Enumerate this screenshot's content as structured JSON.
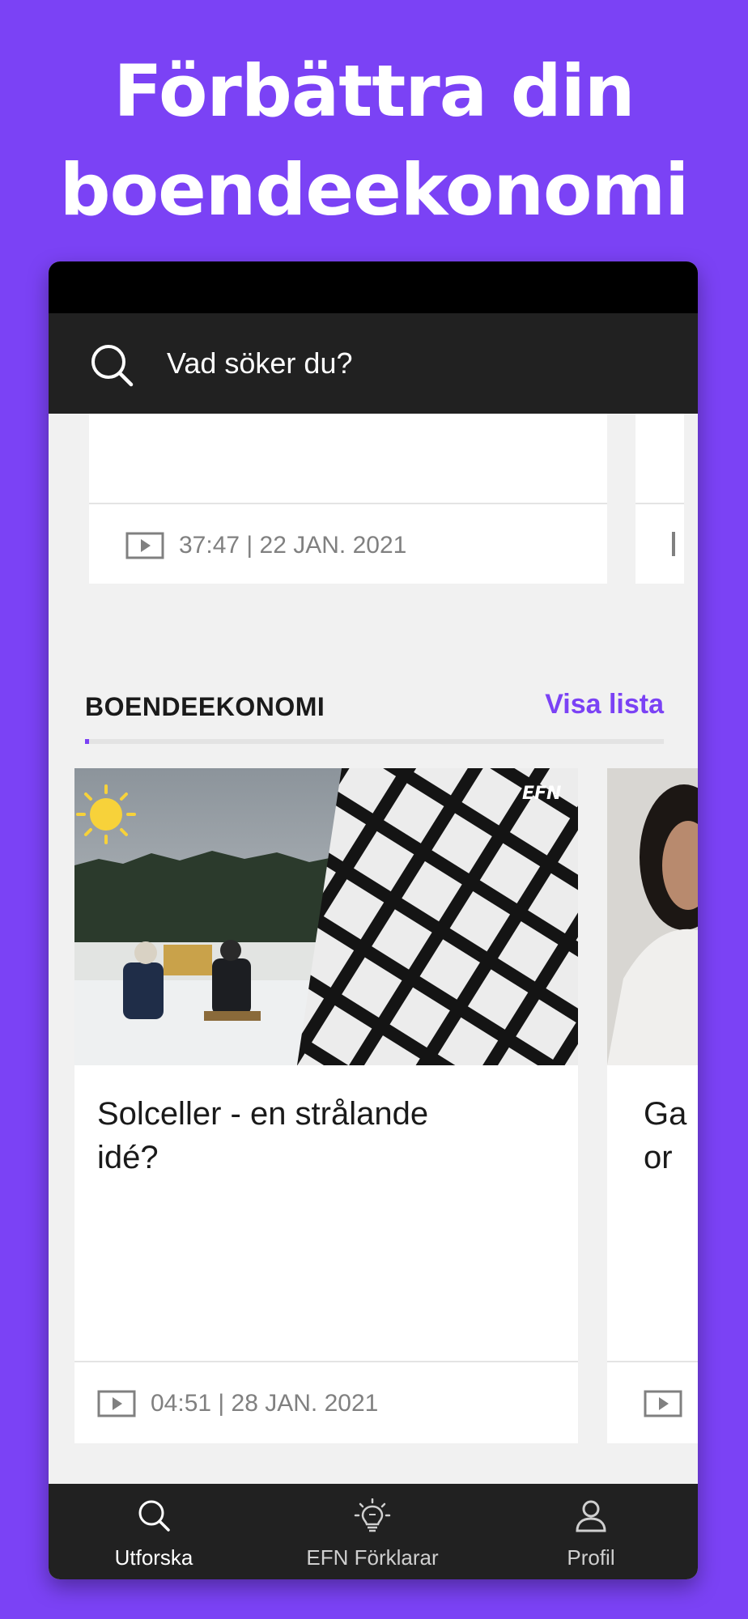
{
  "promo": {
    "headline_line1": "Förbättra din",
    "headline_line2": "boendeekonomi"
  },
  "search": {
    "placeholder": "Vad söker du?",
    "icon": "search-icon"
  },
  "previous_card": {
    "meta": "37:47 | 22 JAN. 2021",
    "icon": "play-icon"
  },
  "section": {
    "title": "BOENDEEKONOMI",
    "link_label": "Visa lista"
  },
  "cards": [
    {
      "title_line1": "Solceller - en strålande",
      "title_line2": "idé?",
      "meta": "04:51 | 28 JAN. 2021",
      "thumbnail_logo": "EFN",
      "thumbnail_icon": "sun-icon"
    },
    {
      "title_line1": "Ga",
      "title_line2": "or"
    }
  ],
  "tabs": [
    {
      "label": "Utforska",
      "icon": "search-icon",
      "active": true
    },
    {
      "label": "EFN Förklarar",
      "icon": "lightbulb-icon",
      "active": false
    },
    {
      "label": "Profil",
      "icon": "person-icon",
      "active": false
    }
  ],
  "colors": {
    "accent": "#7b42f5",
    "dark_bar": "#212121",
    "content_bg": "#f1f1f1",
    "meta_text": "#808080"
  }
}
